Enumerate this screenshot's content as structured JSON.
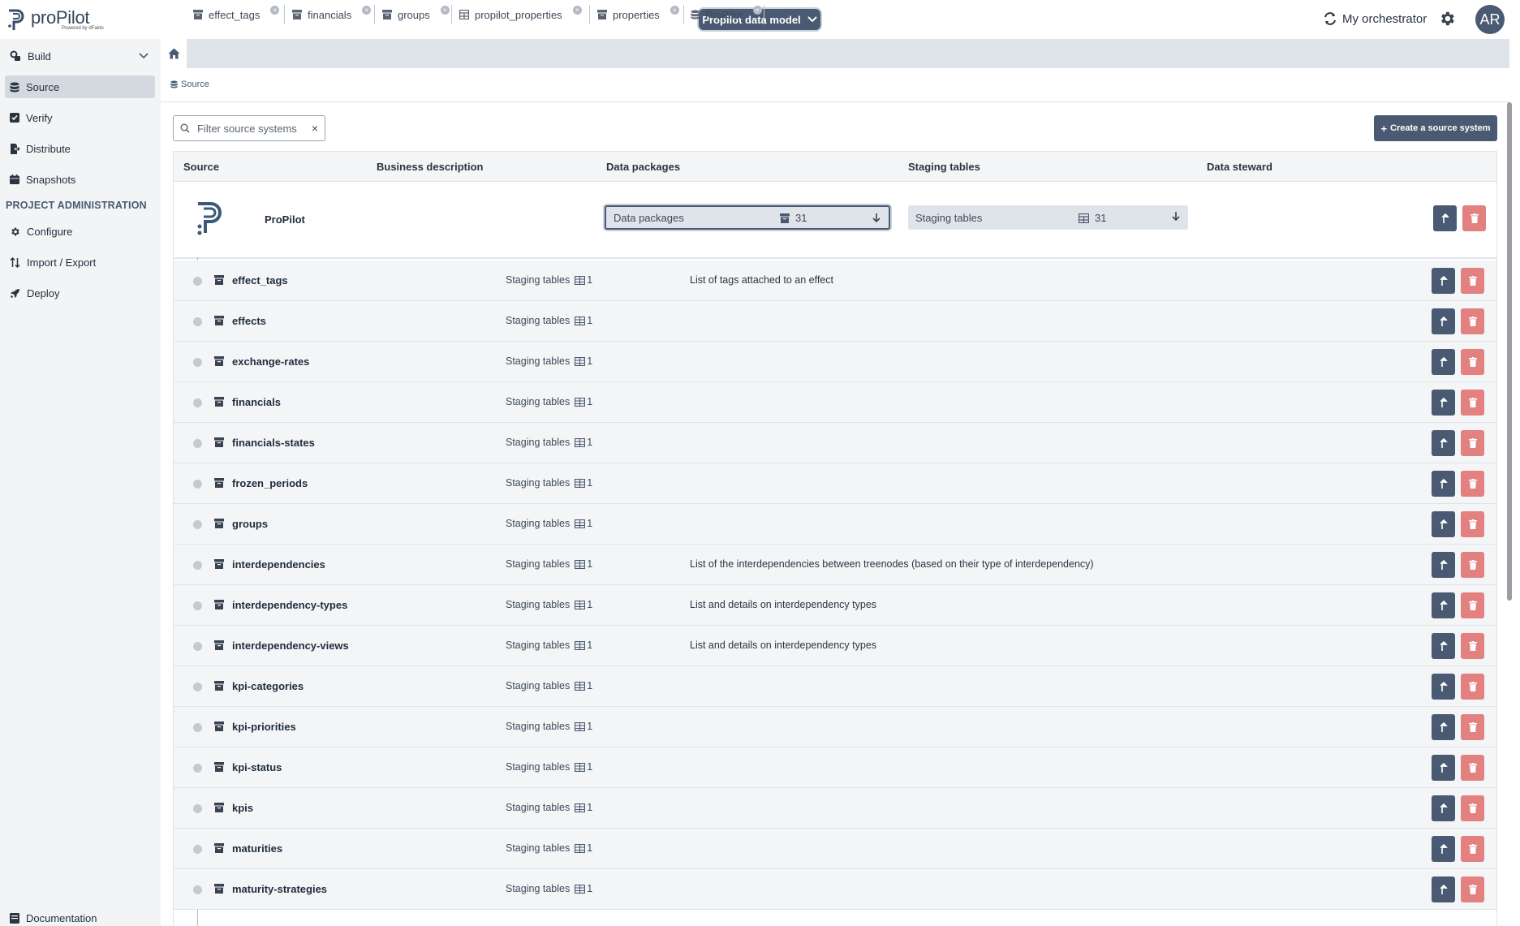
{
  "app": {
    "logo_name": "proPilot",
    "logo_sub": "Powered by dFakto",
    "model_selector": "Propilot data model",
    "orchestrator": "My orchestrator",
    "avatar_initials": "AR"
  },
  "sidebar": {
    "build": "Build",
    "items": [
      {
        "label": "Source",
        "icon": "database-icon",
        "active": true
      },
      {
        "label": "Verify",
        "icon": "checkbox-icon",
        "active": false
      },
      {
        "label": "Distribute",
        "icon": "export-file-icon",
        "active": false
      },
      {
        "label": "Snapshots",
        "icon": "calendar-icon",
        "active": false
      }
    ],
    "section_title": "PROJECT ADMINISTRATION",
    "admin_items": [
      {
        "label": "Configure",
        "icon": "gear-icon"
      },
      {
        "label": "Import / Export",
        "icon": "sort-arrows-icon"
      },
      {
        "label": "Deploy",
        "icon": "rocket-icon"
      }
    ],
    "documentation": "Documentation"
  },
  "tabs": [
    {
      "label": "effect_tags",
      "icon": "archive-icon"
    },
    {
      "label": "financials",
      "icon": "archive-icon"
    },
    {
      "label": "groups",
      "icon": "archive-icon"
    },
    {
      "label": "propilot_properties",
      "icon": "table-icon"
    },
    {
      "label": "properties",
      "icon": "archive-icon"
    },
    {
      "label": "ProPilot",
      "icon": "database-icon"
    }
  ],
  "breadcrumb": "Source",
  "search": {
    "placeholder": "Filter source systems"
  },
  "create_button": "Create a source system",
  "table": {
    "headers": [
      "Source",
      "Business description",
      "Data packages",
      "Staging tables",
      "Data steward"
    ],
    "source": {
      "name": "ProPilot",
      "data_packages_label": "Data packages",
      "data_packages_count": "31",
      "staging_label": "Staging tables",
      "staging_count": "31"
    },
    "staging_link_label": "Staging tables",
    "rows": [
      {
        "name": "effect_tags",
        "count": "1",
        "desc": "List of tags attached to an effect"
      },
      {
        "name": "effects",
        "count": "1",
        "desc": ""
      },
      {
        "name": "exchange-rates",
        "count": "1",
        "desc": ""
      },
      {
        "name": "financials",
        "count": "1",
        "desc": ""
      },
      {
        "name": "financials-states",
        "count": "1",
        "desc": ""
      },
      {
        "name": "frozen_periods",
        "count": "1",
        "desc": ""
      },
      {
        "name": "groups",
        "count": "1",
        "desc": ""
      },
      {
        "name": "interdependencies",
        "count": "1",
        "desc": "List of the interdependencies between treenodes (based on their type of interdependency)"
      },
      {
        "name": "interdependency-types",
        "count": "1",
        "desc": "List and details on interdependency types"
      },
      {
        "name": "interdependency-views",
        "count": "1",
        "desc": "List and details on interdependency types"
      },
      {
        "name": "kpi-categories",
        "count": "1",
        "desc": ""
      },
      {
        "name": "kpi-priorities",
        "count": "1",
        "desc": ""
      },
      {
        "name": "kpi-status",
        "count": "1",
        "desc": ""
      },
      {
        "name": "kpis",
        "count": "1",
        "desc": ""
      },
      {
        "name": "maturities",
        "count": "1",
        "desc": ""
      },
      {
        "name": "maturity-strategies",
        "count": "1",
        "desc": ""
      }
    ]
  },
  "colors": {
    "accent": "#4a5a72",
    "danger": "#e38080",
    "sidebar_bg": "#f3f4f6"
  }
}
